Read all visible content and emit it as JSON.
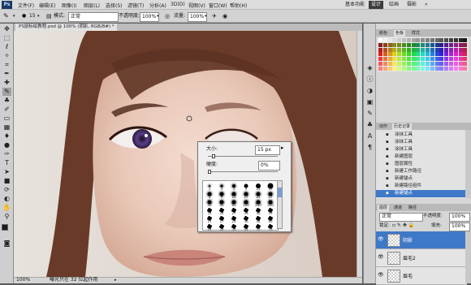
{
  "menu": {
    "logo": "Ps",
    "items": [
      "文件(F)",
      "编辑(E)",
      "图像(I)",
      "图层(L)",
      "选择(S)",
      "滤镜(T)",
      "分析(A)",
      "3D(D)",
      "视图(V)",
      "窗口(W)",
      "帮助(H)"
    ],
    "workspaces": [
      "基本功能",
      "设计",
      "绘画",
      "摄影"
    ],
    "active_workspace": "设计"
  },
  "options": {
    "mode_label": "模式:",
    "mode_value": "正常",
    "opacity_label": "不透明度:",
    "opacity_value": "100%",
    "flow_label": "流量:",
    "flow_value": "100%"
  },
  "document": {
    "tab_title": "PS鼠标绘教程.psd @ 100% (阴影, RGB/8#) *",
    "zoom": "100%",
    "status": "曝光只在 32 位起作用"
  },
  "brush_popup": {
    "size_label": "大小:",
    "size_value": "15 px",
    "hardness_label": "硬度:",
    "hardness_value": "0%",
    "size_fraction": 0.06,
    "hardness_fraction": 0.0,
    "presets": [
      {
        "n": "1",
        "kind": "soft"
      },
      {
        "n": "3",
        "kind": "soft"
      },
      {
        "n": "5",
        "kind": "soft"
      },
      {
        "n": "9",
        "kind": "hard"
      },
      {
        "n": "13",
        "kind": "hard"
      },
      {
        "n": "19",
        "kind": "hard"
      },
      {
        "n": "5",
        "kind": "soft"
      },
      {
        "n": "9",
        "kind": "soft"
      },
      {
        "n": "13",
        "kind": "soft"
      },
      {
        "n": "17",
        "kind": "soft"
      },
      {
        "n": "21",
        "kind": "soft"
      },
      {
        "n": "27",
        "kind": "soft"
      },
      {
        "n": "35",
        "kind": "soft"
      },
      {
        "n": "45",
        "kind": "soft"
      },
      {
        "n": "65",
        "kind": "soft"
      },
      {
        "n": "100",
        "kind": "soft"
      },
      {
        "n": "200",
        "kind": "soft"
      },
      {
        "n": "300",
        "kind": "soft"
      },
      {
        "n": "14",
        "kind": "shape"
      },
      {
        "n": "24",
        "kind": "shape"
      },
      {
        "n": "27",
        "kind": "shape"
      },
      {
        "n": "39",
        "kind": "shape"
      },
      {
        "n": "46",
        "kind": "shape"
      },
      {
        "n": "59",
        "kind": "shape"
      },
      {
        "n": "11",
        "kind": "shape"
      },
      {
        "n": "17",
        "kind": "shape"
      },
      {
        "n": "23",
        "kind": "shape"
      },
      {
        "n": "36",
        "kind": "shape"
      },
      {
        "n": "44",
        "kind": "shape"
      },
      {
        "n": "60",
        "kind": "shape"
      },
      {
        "n": "14",
        "kind": "shape"
      },
      {
        "n": "26",
        "kind": "shape"
      },
      {
        "n": "33",
        "kind": "shape"
      },
      {
        "n": "42",
        "kind": "shape"
      },
      {
        "n": "55",
        "kind": "shape"
      },
      {
        "n": "70",
        "kind": "shape"
      }
    ]
  },
  "panels": {
    "swatch_tabs": [
      "颜色",
      "色板",
      "样式"
    ],
    "history_tabs": [
      "动作",
      "历史记录"
    ],
    "history": [
      "涂抹工具",
      "涂抹工具",
      "涂抹工具",
      "新建图层",
      "图层属性",
      "新建工作路径",
      "新建锚点",
      "新建路径组件",
      "新建锚点"
    ],
    "history_selected": 8,
    "layers_tabs": [
      "图层",
      "通道",
      "路径"
    ],
    "blend_mode": "正常",
    "opacity_label": "不透明度:",
    "opacity_value": "100%",
    "lock_label": "锁定:",
    "fill_label": "填充:",
    "fill_value": "100%",
    "layers": [
      "阴影",
      "眉毛2",
      "眉毛"
    ],
    "layer_selected": 0
  },
  "colors": {
    "accent": "#3e79c8",
    "workspace_active": "#3c3c3c"
  }
}
